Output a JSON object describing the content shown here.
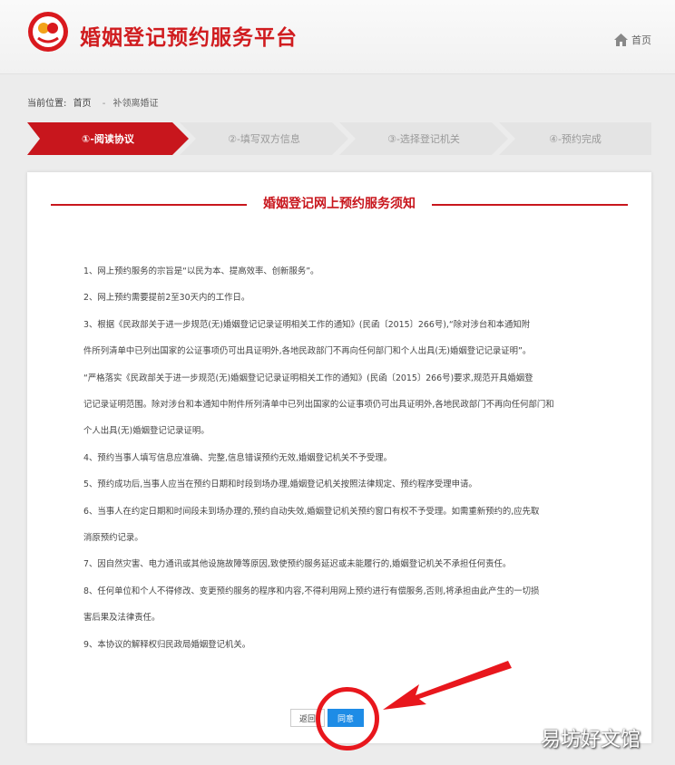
{
  "header": {
    "site_title": "婚姻登记预约服务平台",
    "home_label": "首页"
  },
  "breadcrumb": {
    "prefix": "当前位置:",
    "home": "首页",
    "current": "补领离婚证"
  },
  "steps": [
    {
      "label": "①-阅读协议",
      "active": true
    },
    {
      "label": "②-填写双方信息",
      "active": false
    },
    {
      "label": "③-选择登记机关",
      "active": false
    },
    {
      "label": "④-预约完成",
      "active": false
    }
  ],
  "notice": {
    "title": "婚姻登记网上预约服务须知",
    "lines": [
      "1、网上预约服务的宗旨是“以民为本、提高效率、创新服务”。",
      "2、网上预约需要提前2至30天内的工作日。",
      "3、根据《民政部关于进一步规范(无)婚姻登记记录证明相关工作的通知》(民函〔2015〕266号),“除对涉台和本通知附",
      "件所列清单中已列出国家的公证事项仍可出具证明外,各地民政部门不再向任何部门和个人出具(无)婚姻登记记录证明”。",
      "“严格落实《民政部关于进一步规范(无)婚姻登记记录证明相关工作的通知》(民函〔2015〕266号)要求,规范开具婚姻登",
      "记记录证明范围。除对涉台和本通知中附件所列清单中已列出国家的公证事项仍可出具证明外,各地民政部门不再向任何部门和",
      "个人出具(无)婚姻登记记录证明。",
      "4、预约当事人填写信息应准确、完整,信息错误预约无效,婚姻登记机关不予受理。",
      "5、预约成功后,当事人应当在预约日期和时段到场办理,婚姻登记机关按照法律规定、预约程序受理申请。",
      "6、当事人在约定日期和时间段未到场办理的,预约自动失效,婚姻登记机关预约窗口有权不予受理。如需重新预约的,应先取",
      "消原预约记录。",
      "7、因自然灾害、电力通讯或其他设施故障等原因,致使预约服务延迟或未能履行的,婚姻登记机关不承担任何责任。",
      "8、任何单位和个人不得修改、变更预约服务的程序和内容,不得利用网上预约进行有偿服务,否则,将承担由此产生的一切损",
      "害后果及法律责任。",
      "9、本协议的解释权归民政局婚姻登记机关。"
    ]
  },
  "buttons": {
    "back": "返回",
    "agree": "同意"
  },
  "watermark": "易坊好文馆",
  "colors": {
    "brand_red": "#c8161d",
    "agree_blue": "#1e8ce6",
    "step_inactive": "#e4e4e4"
  }
}
